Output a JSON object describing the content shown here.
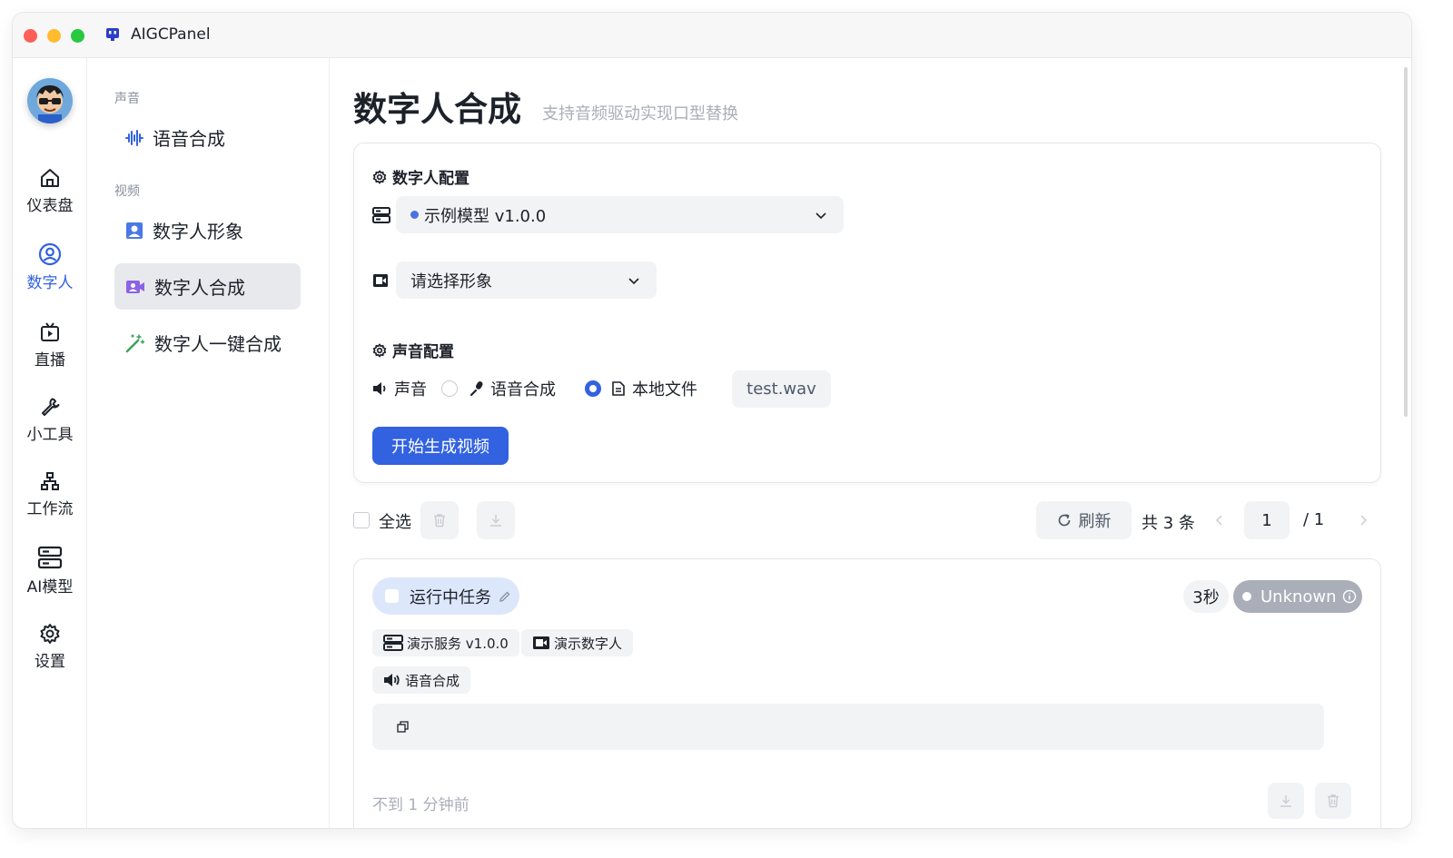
{
  "app": {
    "title": "AIGCPanel"
  },
  "rail": {
    "items": [
      {
        "label": "仪表盘",
        "icon": "home-icon"
      },
      {
        "label": "数字人",
        "icon": "user-circle-icon",
        "active": true
      },
      {
        "label": "直播",
        "icon": "tv-icon"
      },
      {
        "label": "小工具",
        "icon": "wrench-icon"
      },
      {
        "label": "工作流",
        "icon": "workflow-icon"
      },
      {
        "label": "AI模型",
        "icon": "server-icon"
      },
      {
        "label": "设置",
        "icon": "gear-icon"
      }
    ]
  },
  "sidebar": {
    "groups": [
      {
        "label": "声音",
        "items": [
          {
            "label": "语音合成",
            "icon": "waveform-icon"
          }
        ]
      },
      {
        "label": "视频",
        "items": [
          {
            "label": "数字人形象",
            "icon": "portrait-icon"
          },
          {
            "label": "数字人合成",
            "icon": "video-person-icon",
            "active": true
          },
          {
            "label": "数字人一键合成",
            "icon": "magic-wand-icon"
          }
        ]
      }
    ]
  },
  "page": {
    "title": "数字人合成",
    "subtitle": "支持音频驱动实现口型替换"
  },
  "config": {
    "digital_human_title": "数字人配置",
    "model_select": "示例模型 v1.0.0",
    "avatar_placeholder": "请选择形象",
    "voice_title": "声音配置",
    "voice_label": "声音",
    "option_tts": "语音合成",
    "option_local": "本地文件",
    "selected_option": "本地文件",
    "file_name": "test.wav",
    "generate_button": "开始生成视频"
  },
  "toolbar": {
    "select_all": "全选",
    "refresh": "刷新",
    "total": "共 3 条",
    "page_current": "1",
    "page_separator": "/ 1"
  },
  "task": {
    "name": "运行中任务",
    "duration": "3秒",
    "status": "Unknown",
    "tags": {
      "service": "演示服务 v1.0.0",
      "avatar": "演示数字人",
      "voice": "语音合成"
    },
    "created": "不到 1 分钟前"
  },
  "colors": {
    "accent": "#3262e0",
    "status_unknown": "#a9aeb8",
    "task_name_bg": "#dde7fb"
  }
}
